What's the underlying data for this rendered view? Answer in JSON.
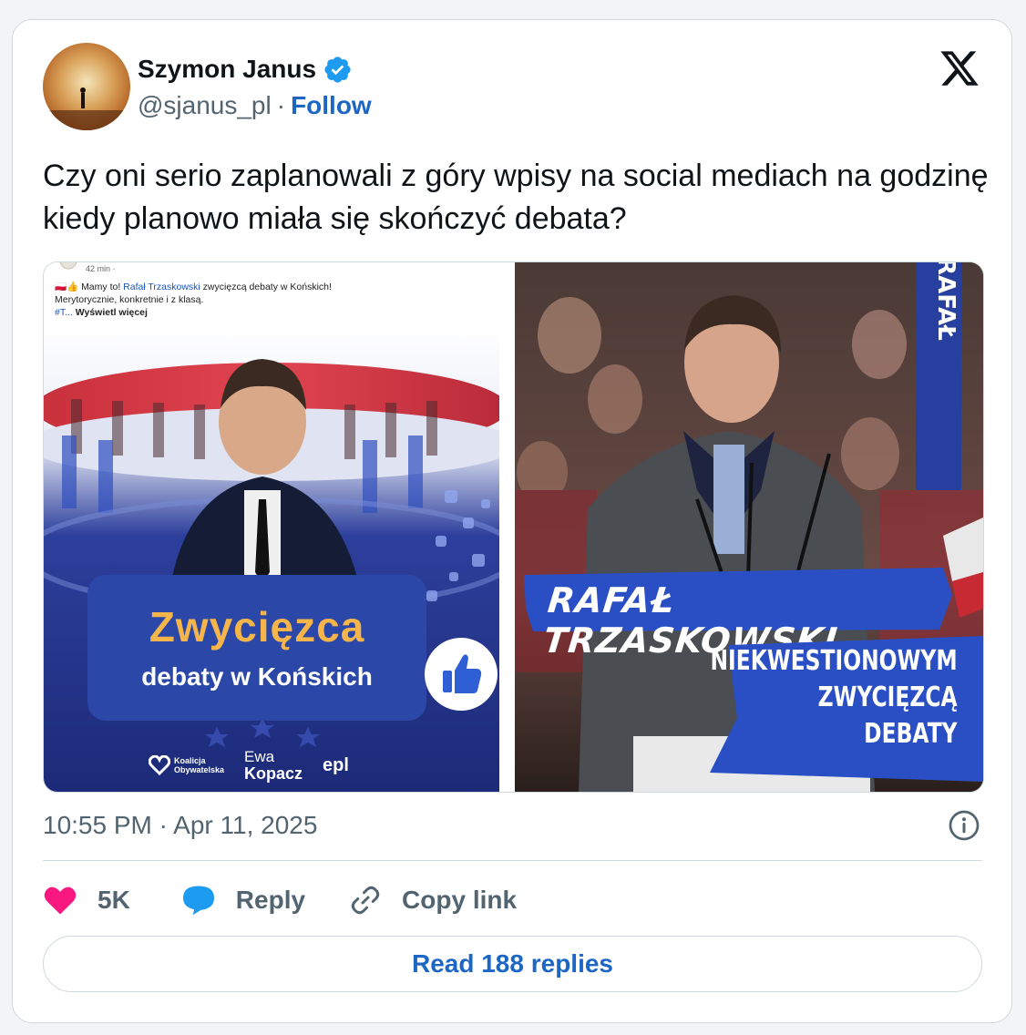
{
  "author": {
    "name": "Szymon Janus",
    "handle": "@sjanus_pl",
    "separator": "·",
    "follow_label": "Follow"
  },
  "tweet": {
    "text": "Czy oni serio zaplanowali z góry wpisy na social mediach na godzinę kiedy planowo miała się skończyć debata?",
    "timestamp": "10:55 PM · Apr 11, 2025"
  },
  "media": {
    "left_post": {
      "time": "42 min · ",
      "line1_prefix": "🇵🇱👍 Mamy to! ",
      "line1_link": "Rafał Trzaskowski",
      "line1_suffix": " zwycięzcą debaty w Końskich!",
      "line2": "Merytorycznie, konkretnie i z klasą.",
      "line3_tag": "#T...",
      "line3_more": " Wyświetl więcej",
      "headline": "Zwycięzca",
      "subheadline": "debaty w Końskich",
      "logo_ko_line1": "Koalicja",
      "logo_ko_line2": "Obywatelska",
      "logo_ek_first": "Ewa",
      "logo_ek_last": "Kopacz",
      "logo_epl": "epl"
    },
    "right_post": {
      "banner_name": "RAFAŁ TRZASKOWSKI",
      "line1": "NIEKWESTIONOWYM",
      "line2": "ZWYCIĘZCĄ",
      "line3": "DEBATY",
      "sign_text": "RAFAŁ"
    }
  },
  "actions": {
    "like_count": "5K",
    "reply_label": "Reply",
    "copy_label": "Copy link"
  },
  "read_replies_label": "Read 188 replies",
  "colors": {
    "link_blue": "#1d66c4",
    "verified_blue": "#1d9bf0",
    "like_pink": "#f91880",
    "muted_gray": "#536471",
    "poster_blue": "#2b48a8",
    "headline_orange": "#f6b54a"
  },
  "icons": {
    "verified": "verified-badge-icon",
    "logo": "x-logo-icon",
    "info": "info-icon",
    "like": "heart-icon",
    "reply": "speech-bubble-icon",
    "copy": "link-icon"
  }
}
